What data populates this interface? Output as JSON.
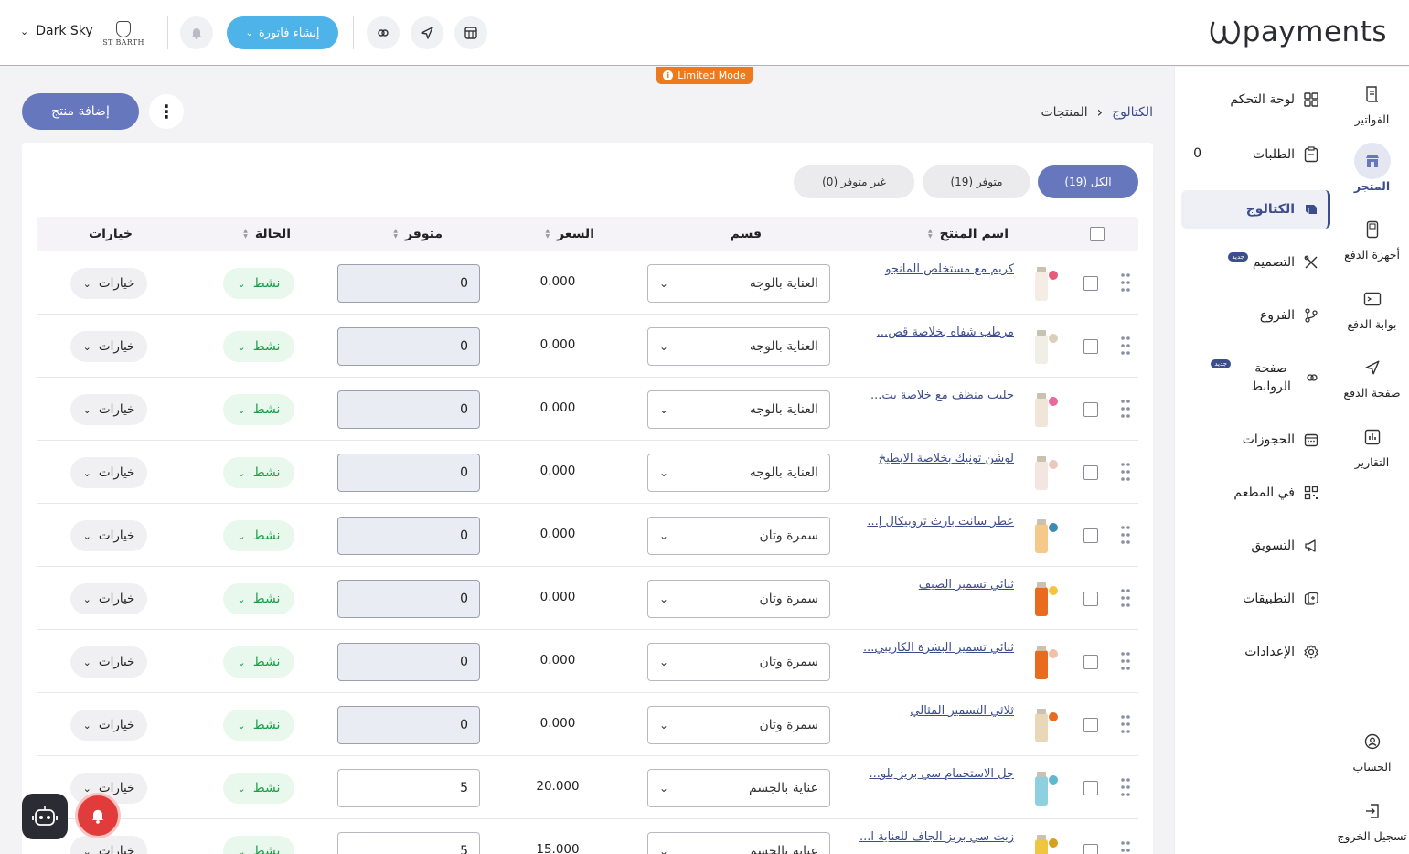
{
  "brand": {
    "logo_text": "payments",
    "store_logo_text": "ST BARTH"
  },
  "header": {
    "account_name": "Dark Sky",
    "create_invoice_label": "إنشاء فاتورة",
    "limited_mode_label": "Limited Mode"
  },
  "rail": [
    {
      "label": "الفواتير",
      "icon": "invoice-icon"
    },
    {
      "label": "المتجر",
      "icon": "store-icon",
      "active": true
    },
    {
      "label": "أجهزة الدفع",
      "icon": "pos-device-icon"
    },
    {
      "label": "بوابة الدفع",
      "icon": "payment-gateway-icon"
    },
    {
      "label": "صفحة الدفع",
      "icon": "send-icon"
    },
    {
      "label": "التقارير",
      "icon": "reports-icon"
    },
    {
      "label": "الحساب",
      "icon": "account-icon"
    },
    {
      "label": "تسجيل الخروج",
      "icon": "logout-icon"
    }
  ],
  "menu": [
    {
      "label": "لوحة التحكم",
      "icon": "dashboard-icon"
    },
    {
      "label": "الطلبات",
      "icon": "orders-icon",
      "count": "0"
    },
    {
      "label": "الكتالوج",
      "icon": "catalog-icon",
      "active": true
    },
    {
      "label": "التصميم",
      "icon": "design-icon",
      "badge": "جديد"
    },
    {
      "label": "الفروع",
      "icon": "branches-icon"
    },
    {
      "label": "صفحة الروابط",
      "icon": "links-icon",
      "badge": "جديد"
    },
    {
      "label": "الحجوزات",
      "icon": "calendar-icon"
    },
    {
      "label": "في المطعم",
      "icon": "qr-icon"
    },
    {
      "label": "التسويق",
      "icon": "megaphone-icon"
    },
    {
      "label": "التطبيقات",
      "icon": "apps-icon"
    },
    {
      "label": "الإعدادات",
      "icon": "settings-icon"
    }
  ],
  "breadcrumb": {
    "root": "الكتالوج",
    "current": "المنتجات"
  },
  "add_product_label": "إضافة منتج",
  "filters": [
    {
      "label": "الكل (19)",
      "active": true
    },
    {
      "label": "متوفر (19)"
    },
    {
      "label": "غير متوفر (0)"
    }
  ],
  "columns": {
    "name": "اسم المنتج",
    "category": "قسم",
    "price": "السعر",
    "stock": "متوفر",
    "status": "الحالة",
    "options": "خيارات"
  },
  "products": [
    {
      "name": "كريم مع مستخلص المانجو",
      "category": "العناية بالوجه",
      "price": "0.000",
      "stock": "0",
      "status": "نشط",
      "options": "خيارات"
    },
    {
      "name": "مرطب شفاه بخلاصة قص...",
      "category": "العناية بالوجه",
      "price": "0.000",
      "stock": "0",
      "status": "نشط",
      "options": "خيارات"
    },
    {
      "name": "حليب منظف مع خلاصة بت...",
      "category": "العناية بالوجه",
      "price": "0.000",
      "stock": "0",
      "status": "نشط",
      "options": "خيارات"
    },
    {
      "name": "لوشن تونيك بخلاصة الابطيخ",
      "category": "العناية بالوجه",
      "price": "0.000",
      "stock": "0",
      "status": "نشط",
      "options": "خيارات"
    },
    {
      "name": "عطر سانت بارث تروبيكال إ...",
      "category": "سمرة وتان",
      "price": "0.000",
      "stock": "0",
      "status": "نشط",
      "options": "خيارات"
    },
    {
      "name": "ثنائي تسمير الصيف",
      "category": "سمرة وتان",
      "price": "0.000",
      "stock": "0",
      "status": "نشط",
      "options": "خيارات"
    },
    {
      "name": "ثنائي تسمير البشرة الكاريبي...",
      "category": "سمرة وتان",
      "price": "0.000",
      "stock": "0",
      "status": "نشط",
      "options": "خيارات"
    },
    {
      "name": "ثلاثي التسمير المثالي",
      "category": "سمرة وتان",
      "price": "0.000",
      "stock": "0",
      "status": "نشط",
      "options": "خيارات"
    },
    {
      "name": "جل الاستحمام سي بريز بلو...",
      "category": "عناية بالجسم",
      "price": "20.000",
      "stock": "5",
      "status": "نشط",
      "options": "خيارات"
    },
    {
      "name": "زيت سي بريز الجاف للعناية ا...",
      "category": "عناية بالجسم",
      "price": "15.000",
      "stock": "5",
      "status": "نشط",
      "options": "خيارات"
    }
  ],
  "colors": {
    "accent": "#6677bd",
    "brand_dark": "#3d4c8c",
    "invoice_btn": "#4eb3e8",
    "limited": "#ed7a1e",
    "status_green": "#1e9e4a"
  }
}
